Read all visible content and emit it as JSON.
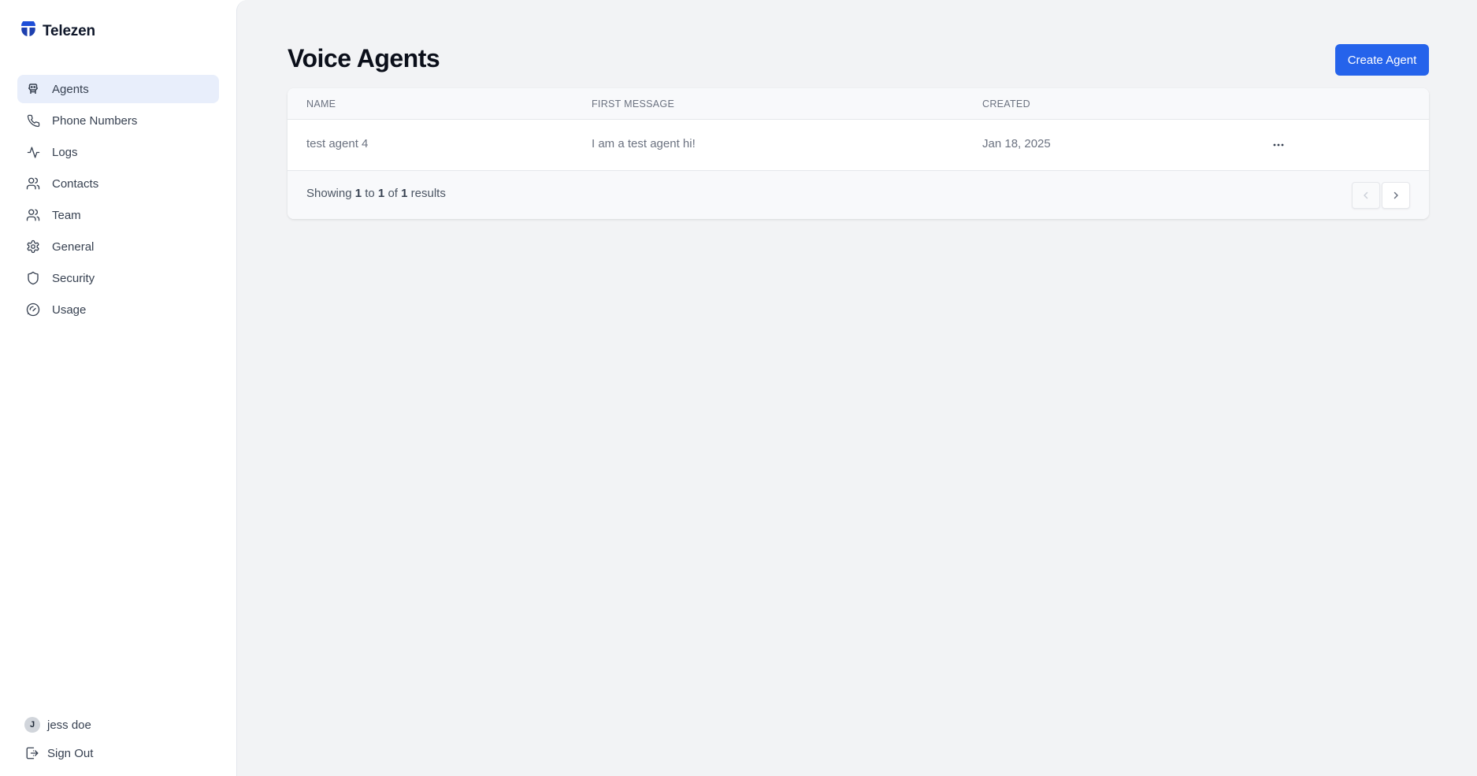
{
  "app": {
    "brand_name": "Telezen",
    "brand_color": "#1d4ed8"
  },
  "sidebar": {
    "items": [
      {
        "label": "Agents",
        "icon": "robot-icon",
        "active": true
      },
      {
        "label": "Phone Numbers",
        "icon": "phone-icon",
        "active": false
      },
      {
        "label": "Logs",
        "icon": "activity-icon",
        "active": false
      },
      {
        "label": "Contacts",
        "icon": "users-icon",
        "active": false
      },
      {
        "label": "Team",
        "icon": "users-icon",
        "active": false
      },
      {
        "label": "General",
        "icon": "gear-icon",
        "active": false
      },
      {
        "label": "Security",
        "icon": "shield-icon",
        "active": false
      },
      {
        "label": "Usage",
        "icon": "gauge-icon",
        "active": false
      }
    ],
    "user": {
      "initial": "J",
      "name": "jess doe"
    },
    "sign_out_label": "Sign Out"
  },
  "main": {
    "title": "Voice Agents",
    "create_button_label": "Create Agent",
    "accent_color": "#2563eb",
    "table": {
      "columns": [
        "NAME",
        "FIRST MESSAGE",
        "CREATED"
      ],
      "rows": [
        {
          "name": "test agent 4",
          "first_message": "I am a test agent hi!",
          "created": "Jan 18, 2025",
          "actions": "..."
        }
      ],
      "footer": {
        "prefix": "Showing",
        "from": "1",
        "to_word": "to",
        "to": "1",
        "of_word": "of",
        "total": "1",
        "suffix": "results"
      },
      "pagination": {
        "prev_icon": "chevron-left-icon",
        "next_icon": "chevron-right-icon"
      }
    }
  }
}
